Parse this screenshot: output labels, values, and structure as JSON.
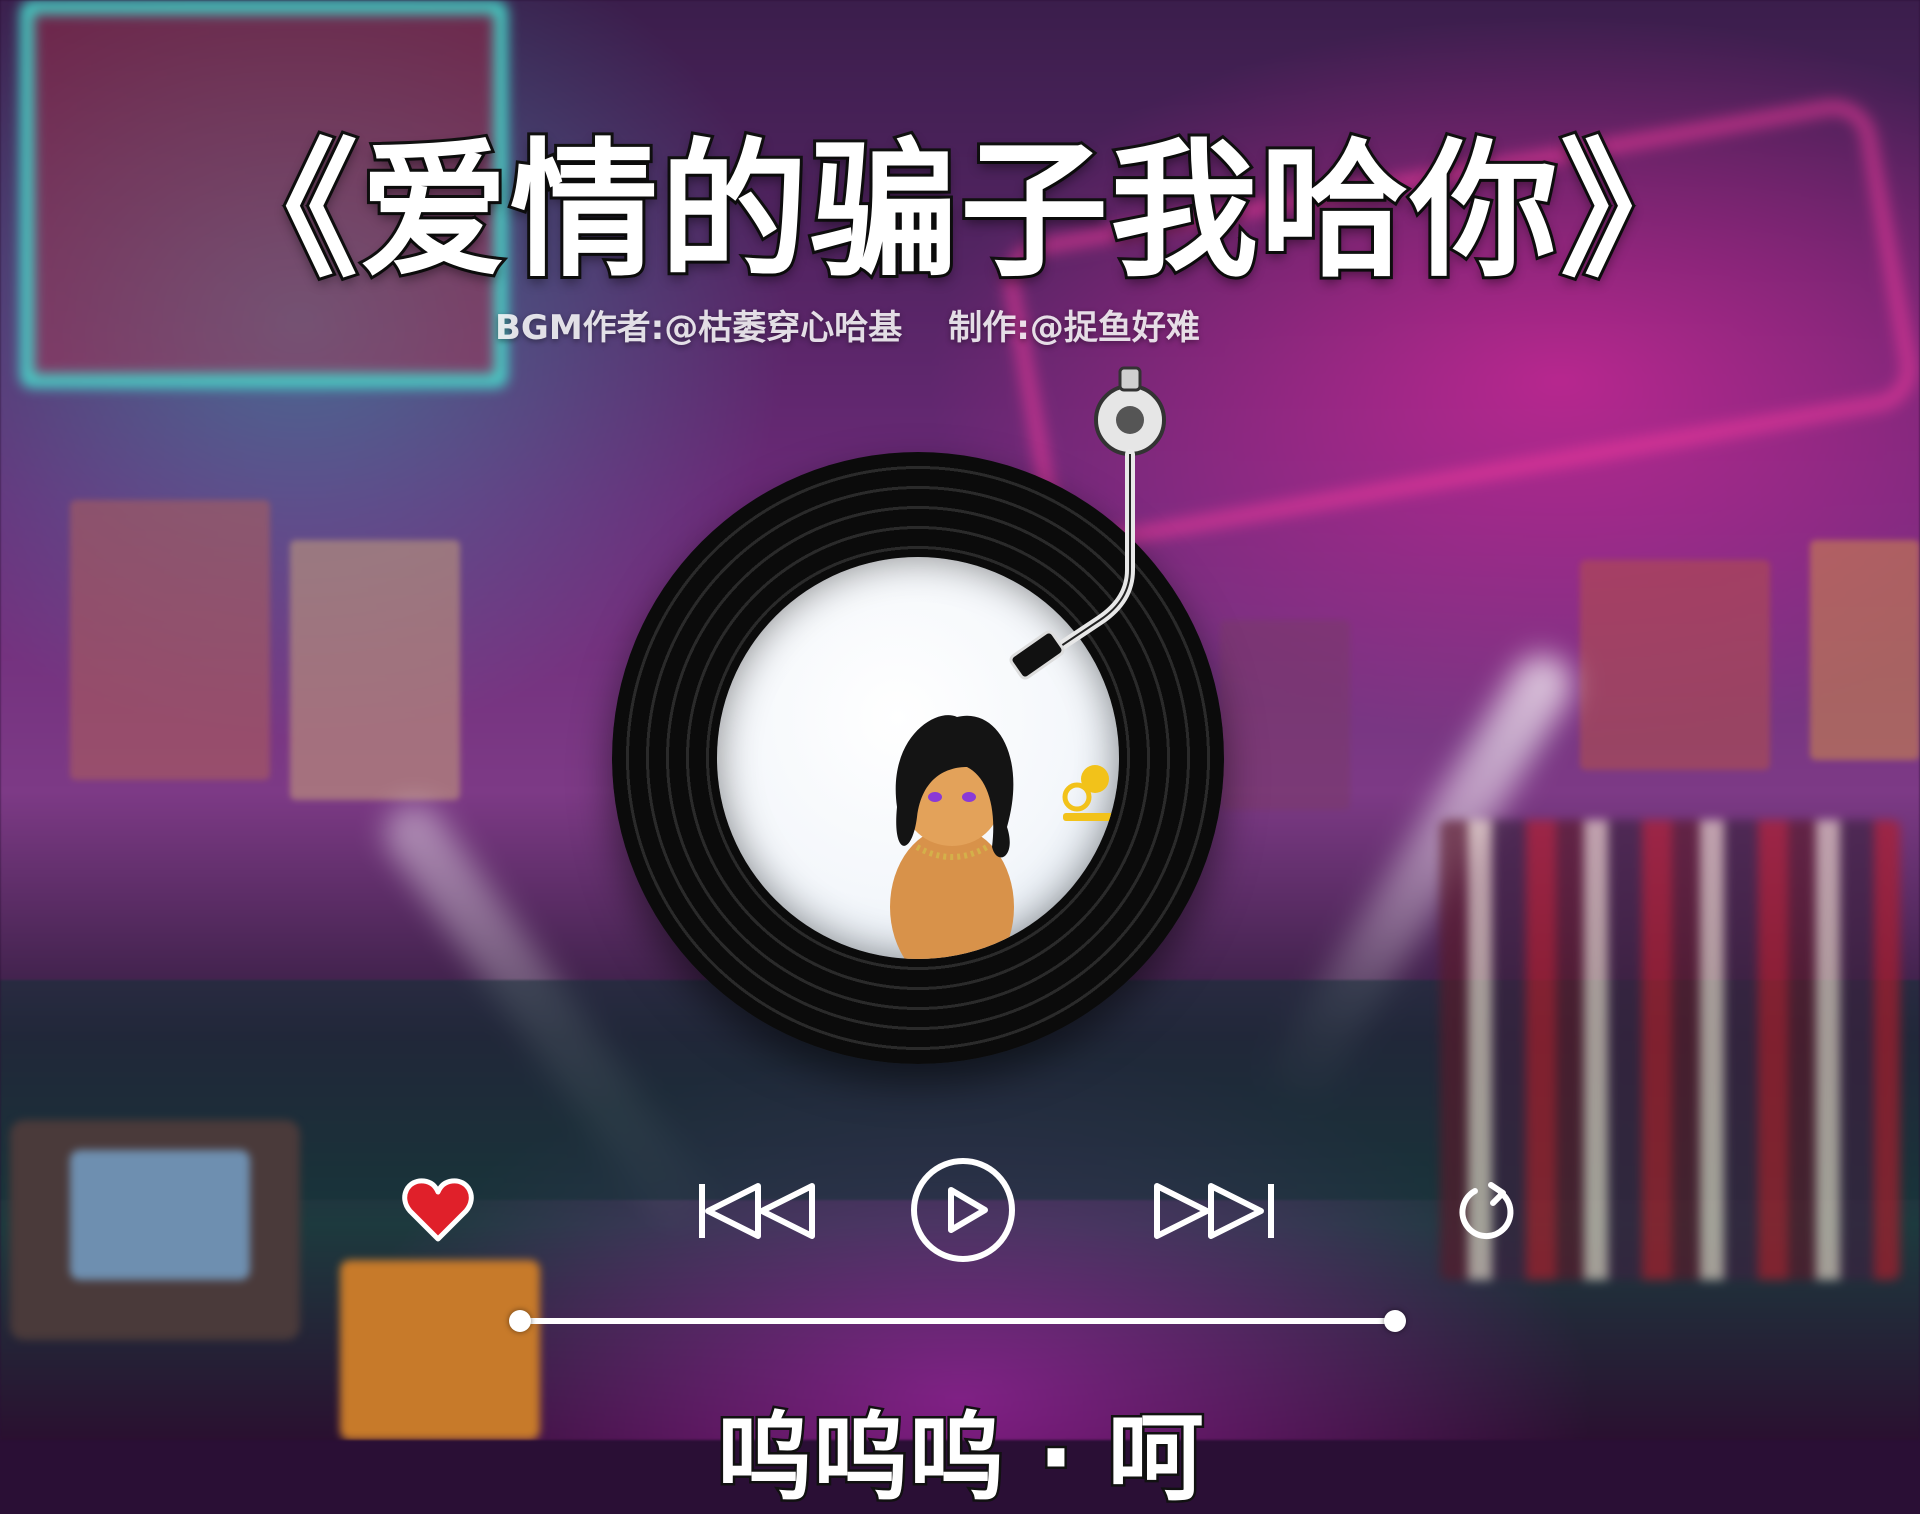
{
  "video": {
    "title": "《爱情的骗子我哈你》",
    "credits": [
      "BGM作者:@枯萎穿心哈基",
      "制作:@捉鱼好难"
    ],
    "lyric_partial": "呜呜呜 · 呵"
  },
  "player": {
    "controls": [
      {
        "name": "like",
        "icon": "heart-icon",
        "state": "liked"
      },
      {
        "name": "previous",
        "icon": "skip-previous-icon"
      },
      {
        "name": "play",
        "icon": "play-icon"
      },
      {
        "name": "next",
        "icon": "skip-next-icon"
      },
      {
        "name": "repeat",
        "icon": "repeat-icon"
      }
    ],
    "progress": 0
  },
  "colors": {
    "accent_heart": "#e0202a",
    "control_white": "#ffffff",
    "record_black": "#0b0b0b"
  }
}
